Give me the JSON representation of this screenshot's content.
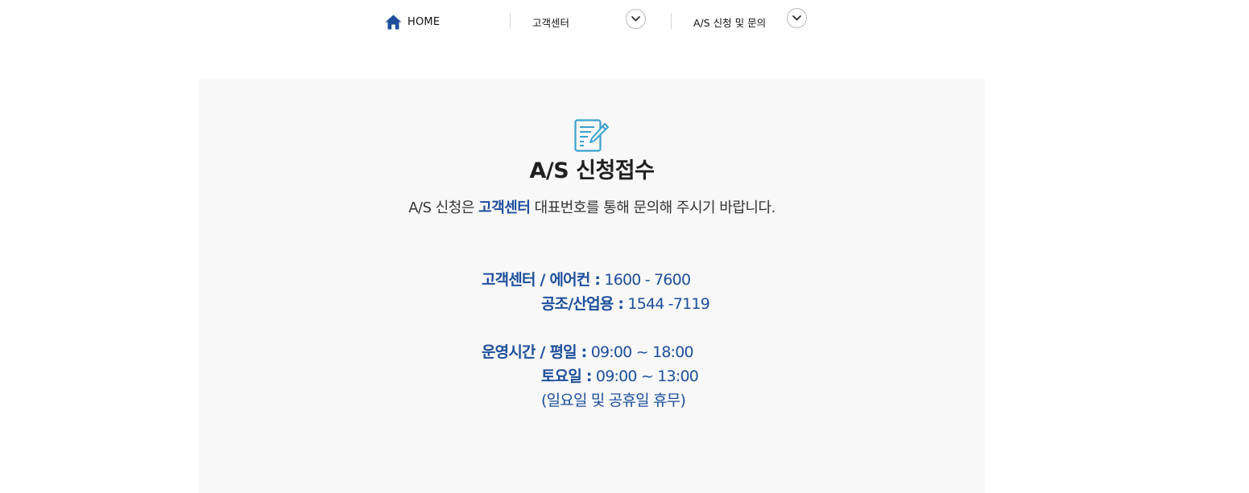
{
  "breadcrumb": {
    "home_label": "HOME",
    "home_icon": "home-icon",
    "items": [
      {
        "label": "고객센터",
        "icon": "chevron-down-icon"
      },
      {
        "label": "A/S 신청 및 문의",
        "icon": "chevron-down-icon"
      }
    ]
  },
  "main": {
    "icon": "document-edit-icon",
    "title": "A/S 신청접수",
    "description": {
      "before": "A/S 신청은",
      "highlight": "고객센터",
      "after": "대표번호를 통해 문의해 주시기 바랍니다."
    },
    "contacts": [
      {
        "label": "고객센터 / 에어컨 :",
        "value": "1600 - 7600"
      },
      {
        "label": "공조/산업용 :",
        "value": "1544 -7119"
      }
    ],
    "hours": [
      {
        "label": "운영시간 / 평일 :",
        "value": "09:00 ~ 18:00"
      },
      {
        "label": "토요일 :",
        "value": "09:00 ~ 13:00"
      }
    ],
    "holiday_note": "(일요일 및 공휴일 휴무)"
  },
  "colors": {
    "accent": "#1d4f9c",
    "icon_blue": "#3aa1d0",
    "panel_bg": "#f8f8f8",
    "text_dark": "#1f1f1f"
  }
}
